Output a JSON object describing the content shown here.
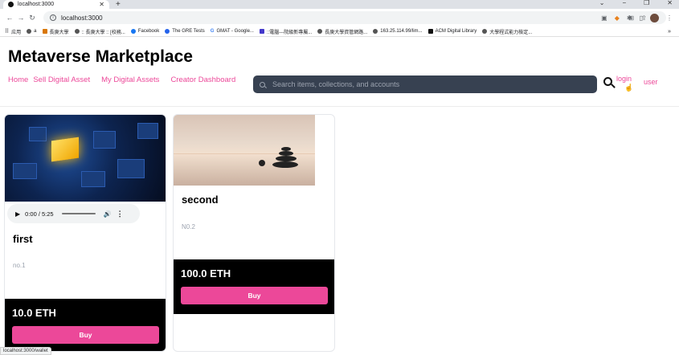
{
  "browser": {
    "tab_title": "localhost:3000",
    "tab_close": "✕",
    "new_tab": "+",
    "url": "localhost:3000",
    "bookmarks": [
      "应用",
      "a",
      "長庚大學",
      ":: 長庚大學 :: [校務...",
      "Facebook",
      "The GRE Tests",
      "GMAT - Google...",
      "::電腦---院級新專屬...",
      "長庚大學資管網路...",
      "163.25.114.99/lim...",
      "ACM Digital Library",
      "大學程式能力檢定..."
    ],
    "bookmarks_more": "»",
    "status_url": "localhost:3000/wallet"
  },
  "header": {
    "title": "Metaverse Marketplace",
    "nav": [
      "Home",
      "Sell Digital Asset",
      "My Digital Assets",
      "Creator Dashboard"
    ],
    "search_placeholder": "Search items, collections, and accounts",
    "login_label": "login",
    "user_label": "user"
  },
  "items": [
    {
      "name": "first",
      "description": "no.1",
      "price": "10.0 ETH",
      "buy_label": "Buy",
      "audio": {
        "time": "0:00 / 5:25"
      }
    },
    {
      "name": "second",
      "description": "N0.2",
      "price": "100.0 ETH",
      "buy_label": "Buy"
    }
  ],
  "icons": {
    "search": "search-icon",
    "play": "play-icon",
    "volume": "volume-icon"
  },
  "colors": {
    "accent": "#ec4899",
    "search_bg": "#374151",
    "price_bg": "#000000"
  }
}
